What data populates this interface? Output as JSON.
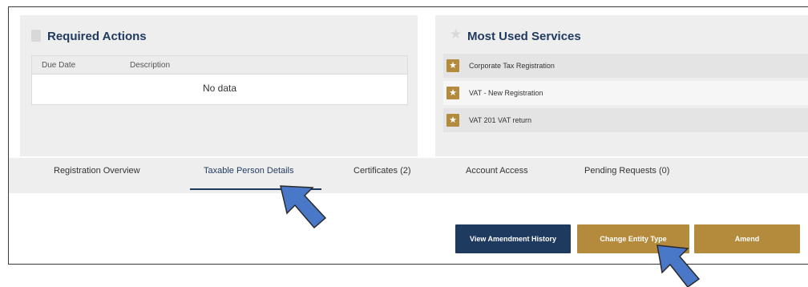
{
  "required_actions": {
    "title": "Required Actions",
    "columns": [
      "Due Date",
      "Description"
    ],
    "empty_text": "No data"
  },
  "most_used_services": {
    "title": "Most Used Services",
    "items": [
      {
        "label": "Corporate Tax Registration"
      },
      {
        "label": "VAT - New Registration"
      },
      {
        "label": "VAT 201 VAT return"
      }
    ]
  },
  "tabs": [
    {
      "label": "Registration Overview",
      "active": false
    },
    {
      "label": "Taxable Person Details",
      "active": true
    },
    {
      "label": "Certificates (2)",
      "active": false
    },
    {
      "label": "Account Access",
      "active": false
    },
    {
      "label": "Pending Requests (0)",
      "active": false
    }
  ],
  "buttons": {
    "view_history": "View Amendment History",
    "change_entity": "Change Entity Type",
    "amend": "Amend"
  },
  "colors": {
    "navy": "#1f3a5f",
    "gold": "#b48b3d",
    "arrow_blue": "#4a78c9"
  }
}
